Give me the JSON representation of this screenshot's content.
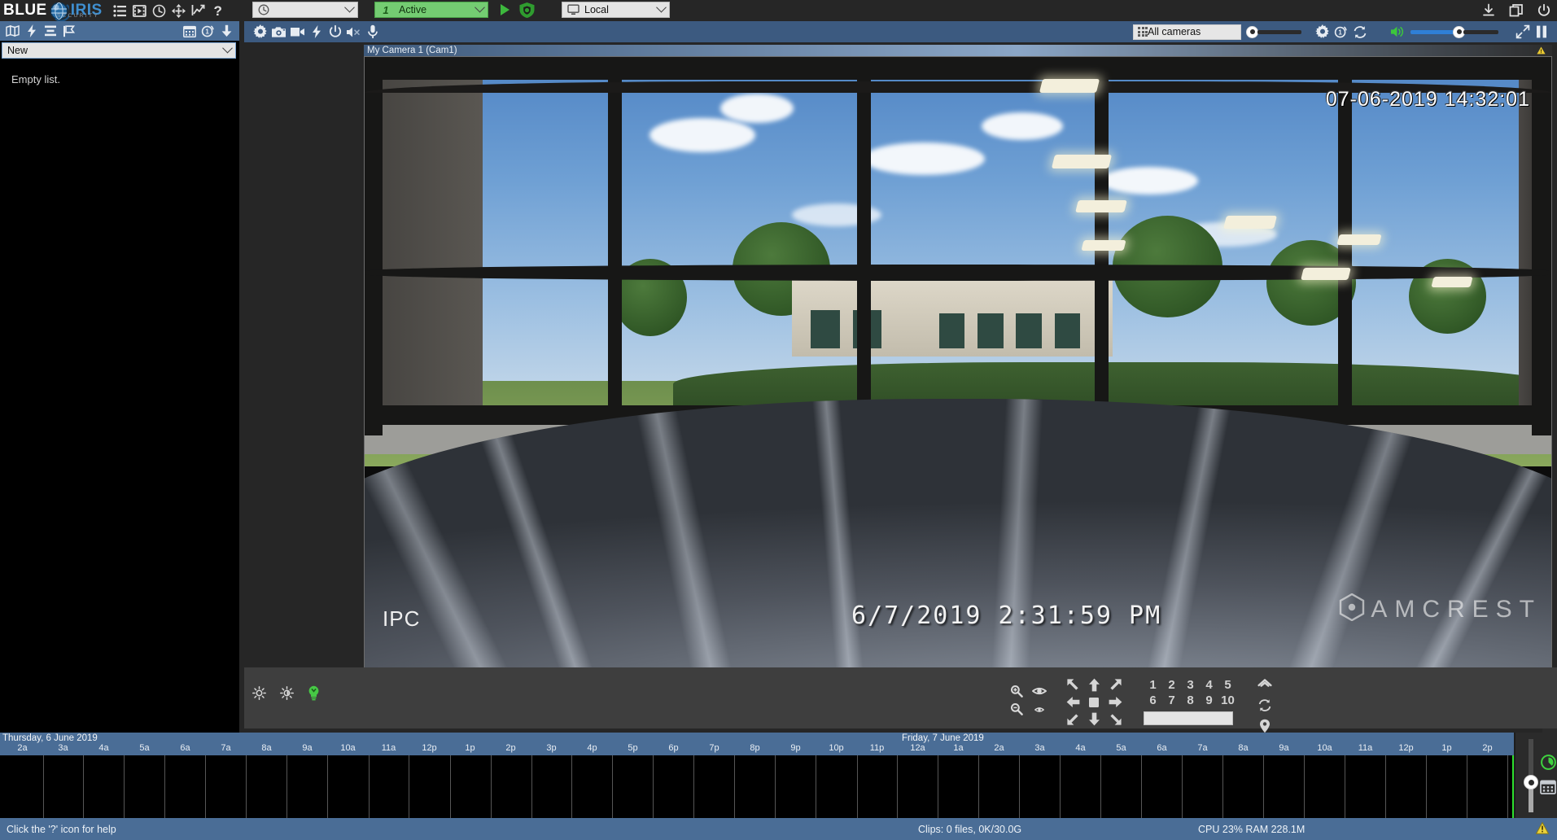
{
  "app": {
    "brand_blue": "BLUE",
    "brand_iris": "IRIS",
    "brand_sub": "SECURITY",
    "accent_blue": "#3f8fd0",
    "toolbar_blue": "#4a6d96",
    "active_green": "#74cc72"
  },
  "topbar": {
    "icons": [
      {
        "name": "list-icon",
        "label": "Camera list"
      },
      {
        "name": "clips-icon",
        "label": "Clips"
      },
      {
        "name": "clock-icon",
        "label": "Schedule"
      },
      {
        "name": "move-icon",
        "label": "Move"
      },
      {
        "name": "stats-icon",
        "label": "Statistics"
      },
      {
        "name": "help-icon",
        "label": "?"
      }
    ],
    "profile_combo": {
      "value": "",
      "icon": "clock-icon"
    },
    "status_combo": {
      "number": "1",
      "value": "Active"
    },
    "local_combo": {
      "value": "Local",
      "icon": "monitor-icon"
    },
    "play_label": "Play",
    "shield_label": "Protect",
    "right_icons": [
      {
        "name": "download-icon"
      },
      {
        "name": "restore-window-icon"
      },
      {
        "name": "power-icon"
      }
    ]
  },
  "left_toolbar": {
    "icons": [
      {
        "name": "map-icon"
      },
      {
        "name": "lightning-icon"
      },
      {
        "name": "list-rows-icon"
      },
      {
        "name": "flag-icon"
      }
    ],
    "right_icons": [
      {
        "name": "calendar-icon"
      },
      {
        "name": "alert-clock-icon"
      },
      {
        "name": "download-arrow-icon"
      }
    ]
  },
  "camera_toolbar": {
    "icons": [
      {
        "name": "gear-icon"
      },
      {
        "name": "snapshot-icon"
      },
      {
        "name": "record-icon"
      },
      {
        "name": "trigger-icon"
      },
      {
        "name": "power-icon"
      },
      {
        "name": "speaker-mute-icon"
      },
      {
        "name": "microphone-icon"
      }
    ],
    "camera_select": {
      "value": "All cameras",
      "icon": "grid-icon"
    },
    "left_slider_percent": 0,
    "right_icons": [
      {
        "name": "gear-icon"
      },
      {
        "name": "alert-clock-icon"
      },
      {
        "name": "refresh-icon"
      }
    ],
    "volume": {
      "icon": "speaker-icon",
      "percent": 55
    },
    "expand_icon": "expand-icon",
    "pause_icon": "pause-icon"
  },
  "left_panel": {
    "list_select": {
      "value": "New"
    },
    "empty_text": "Empty list.",
    "scroll_up_icon": "chevron-up-icon",
    "scroll_down_icon": "chevron-down-icon",
    "zoom_in_icon": "zoom-in-icon",
    "zoom_out_icon": "zoom-out-icon"
  },
  "video": {
    "camera_label": "My Camera 1 (Cam1)",
    "overlay_timestamp": "07-06-2019 14:32:01",
    "overlay_bottom_timestamp": "6/7/2019 2:31:59 PM",
    "overlay_name": "IPC",
    "watermark": "AMCREST",
    "warning_icon": "warning-triangle-icon"
  },
  "ptz": {
    "brightness_up_icon": "brightness-up-icon",
    "brightness_down_icon": "brightness-down-icon",
    "lamp_icon": "lightbulb-icon",
    "zoom_in_icon": "zoom-in-icon",
    "zoom_out_icon": "zoom-out-icon",
    "iris_open_icon": "iris-open-icon",
    "iris_close_icon": "iris-close-icon",
    "directions": [
      "arrow-up-left",
      "arrow-up",
      "arrow-up-right",
      "arrow-left",
      "stop-square",
      "arrow-right",
      "arrow-down-left",
      "arrow-down",
      "arrow-down-right"
    ],
    "presets_row1": [
      "1",
      "2",
      "3",
      "4",
      "5"
    ],
    "presets_row2": [
      "6",
      "7",
      "8",
      "9",
      "10"
    ],
    "preset_select_value": "",
    "home_icon": "home-icon",
    "cycle_icon": "cycle-icon",
    "location_icon": "location-pin-icon"
  },
  "timeline": {
    "day1_label": "Thursday, 6 June 2019",
    "day2_label": "Friday, 7 June 2019",
    "hours": [
      "2a",
      "3a",
      "4a",
      "5a",
      "6a",
      "7a",
      "8a",
      "9a",
      "10a",
      "11a",
      "12p",
      "1p",
      "2p",
      "3p",
      "4p",
      "5p",
      "6p",
      "7p",
      "8p",
      "9p",
      "10p",
      "11p",
      "12a",
      "1a",
      "2a",
      "3a",
      "4a",
      "5a",
      "6a",
      "7a",
      "8a",
      "9a",
      "10a",
      "11a",
      "12p",
      "1p",
      "2p"
    ],
    "day2_start_index": 22,
    "now_marker_color": "#2ee02e",
    "zoom_slider_percent": 52,
    "clock_icon": "green-clock-icon",
    "calendar_icon": "calendar-icon"
  },
  "statusbar": {
    "help_text": "Click the '?' icon for help",
    "clips_text": "Clips: 0 files, 0K/30.0G",
    "cpu_text": "CPU 23% RAM 228.1M",
    "warning_icon": "warning-triangle-icon"
  }
}
